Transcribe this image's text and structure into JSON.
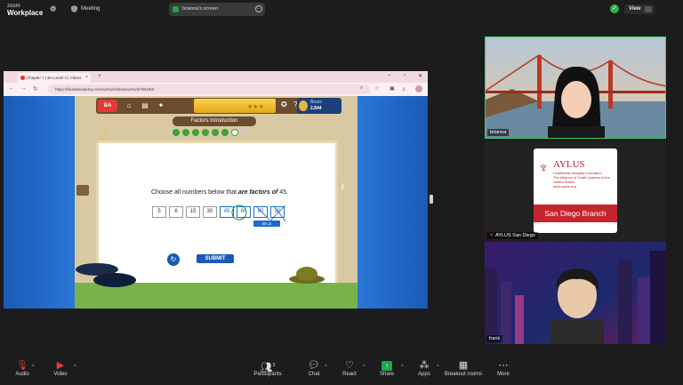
{
  "zoom": {
    "brand_line1": "zoom",
    "brand_line2": "Workplace",
    "meeting_label": "Meeting",
    "shared_screen_label": "brianna's screen",
    "view_label": "View"
  },
  "browser": {
    "tab_title": "Chapter 7 | BA Level 4 | Classr",
    "url": "https://beastacademy.com/school/classrooms/4/7/B19/6"
  },
  "game": {
    "logo": "BA",
    "player_name": "Bruce",
    "player_points": "2,844",
    "section_title": "Factors Introduction",
    "progress_done": 6,
    "progress_total": 8,
    "question_prefix": "Choose all numbers below that ",
    "question_emphasis": "are factors of",
    "question_suffix": " 45.",
    "options": [
      "5",
      "6",
      "15",
      "30",
      "45",
      "60",
      "80",
      "90"
    ],
    "tooltip": "Back",
    "submit_label": "SUBMIT"
  },
  "participants": [
    {
      "name": "brianna"
    },
    {
      "name": "AYLUS San Diego"
    },
    {
      "name": "frank"
    }
  ],
  "aylus_card": {
    "brand": "AYLUS",
    "tagline": "Leadership Integrity Innovation",
    "subtitle": "The Alliance of Youth Leaders in the United States",
    "site": "www.aylus.org",
    "branch": "San Diego Branch"
  },
  "controls": {
    "audio": "Audio",
    "video": "Video",
    "participants": "Participants",
    "participants_count": "3",
    "chat": "Chat",
    "react": "React",
    "share": "Share",
    "apps": "Apps",
    "breakout": "Breakout rooms",
    "more": "More"
  }
}
